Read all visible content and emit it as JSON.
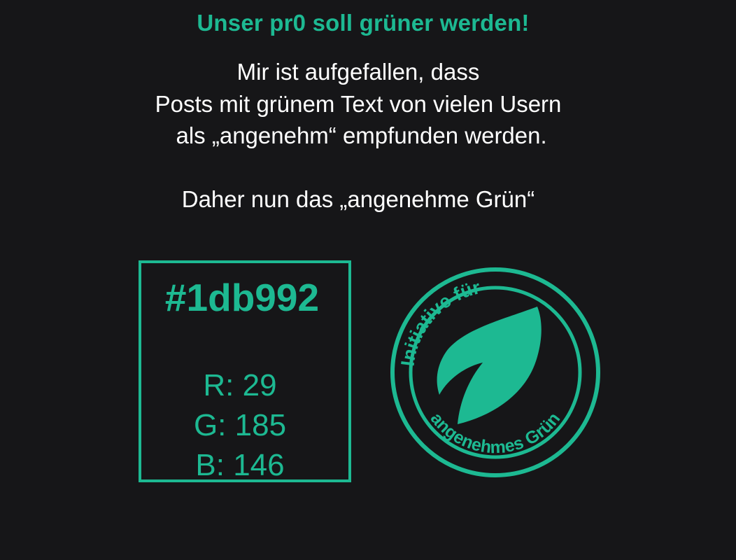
{
  "headline": "Unser pr0 soll grüner werden!",
  "message": {
    "line1": "Mir ist aufgefallen, dass",
    "line2": "Posts mit grünem Text von vielen Usern",
    "line3": " als „angenehm“ empfunden werden.",
    "line4": "Daher nun das „angenehme Grün“"
  },
  "swatch": {
    "hex": "#1db992",
    "r": "R: 29",
    "g": "G: 185",
    "b": "B: 146"
  },
  "seal": {
    "top_text": "Initiative für",
    "bottom_text": "angenehmes Grün",
    "icon": "leaf-icon"
  },
  "colors": {
    "accent": "#1db992",
    "background": "#161618",
    "text": "#ffffff"
  }
}
